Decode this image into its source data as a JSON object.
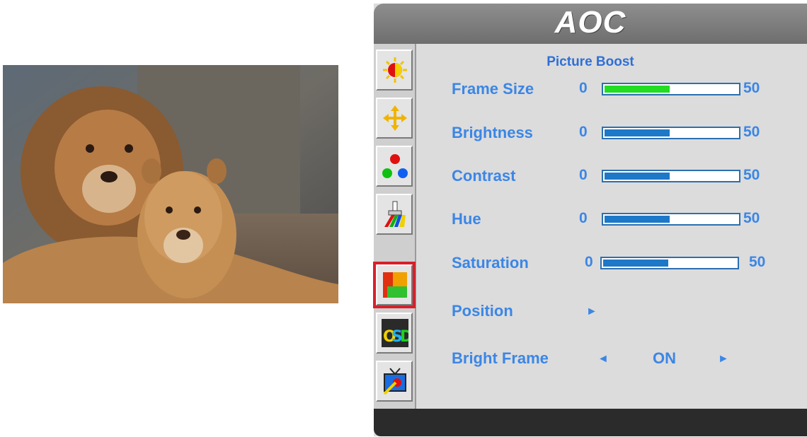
{
  "photo": {
    "alt": "lions"
  },
  "osd": {
    "brand": "AOC",
    "menu_title": "Picture Boost",
    "rail_icons": [
      "luminance-icon",
      "image-setup-icon",
      "color-setup-icon",
      "color-boost-icon",
      "picture-boost-icon",
      "osd-setup-icon",
      "extra-icon"
    ],
    "selected_icon_index": 4,
    "sliders": [
      {
        "label": "Frame Size",
        "min": "0",
        "max": "50",
        "fill_fraction": 0.48,
        "fill_color": "green"
      },
      {
        "label": "Brightness",
        "min": "0",
        "max": "50",
        "fill_fraction": 0.48,
        "fill_color": "blue"
      },
      {
        "label": "Contrast",
        "min": "0",
        "max": "50",
        "fill_fraction": 0.48,
        "fill_color": "blue"
      },
      {
        "label": "Hue",
        "min": "0",
        "max": "50",
        "fill_fraction": 0.48,
        "fill_color": "blue"
      },
      {
        "label": "Saturation",
        "min": "0",
        "max": "50",
        "fill_fraction": 0.48,
        "fill_color": "blue"
      }
    ],
    "position": {
      "label": "Position",
      "arrow": "►"
    },
    "bright_frame": {
      "label": "Bright Frame",
      "left_arrow": "◄",
      "value": "ON",
      "right_arrow": "►"
    }
  }
}
